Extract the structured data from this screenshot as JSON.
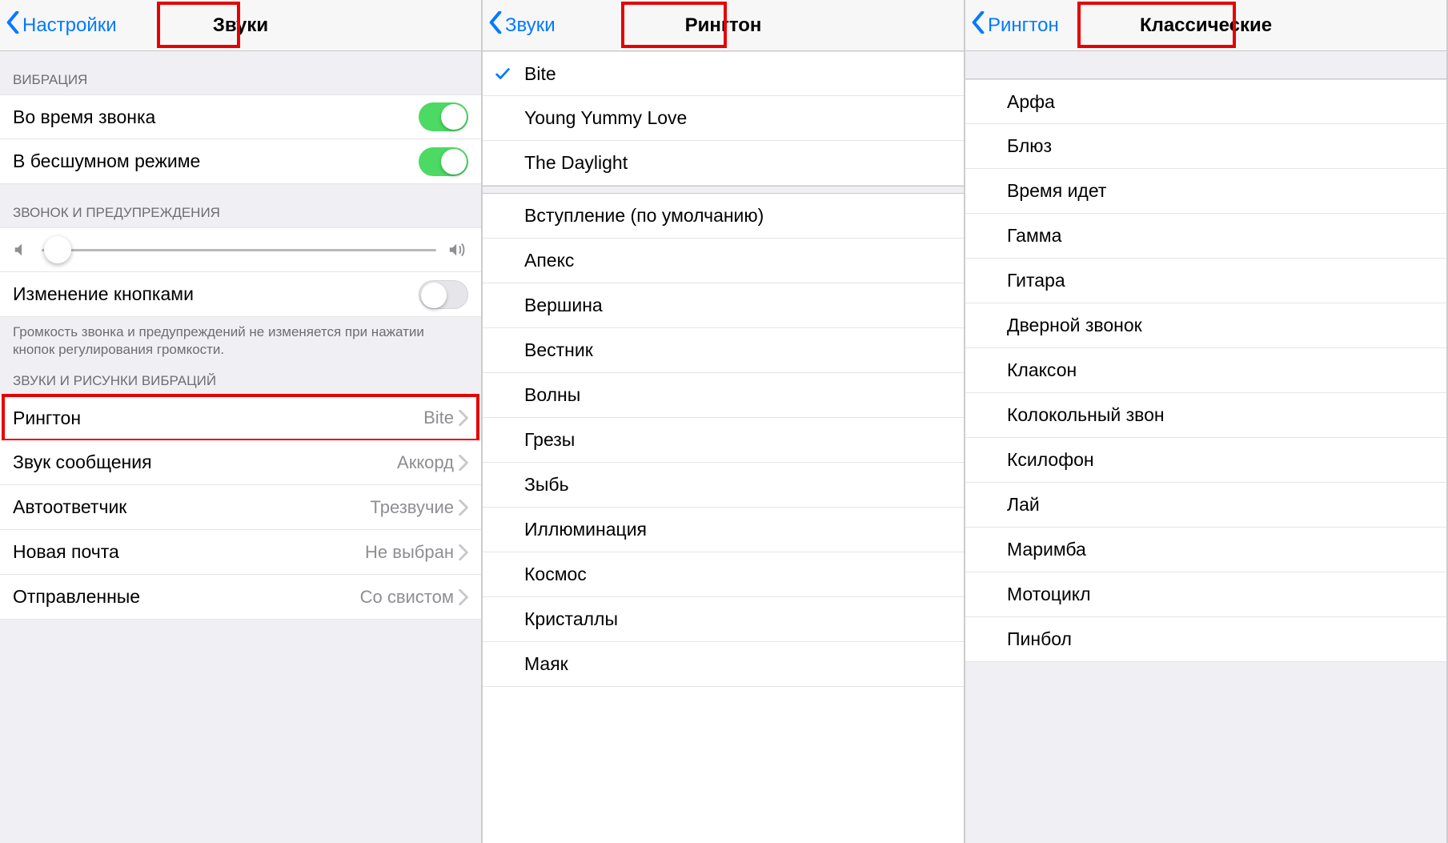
{
  "screen1": {
    "back": "Настройки",
    "title": "Звуки",
    "section_vibration": "Вибрация",
    "row_during_call": "Во время звонка",
    "row_silent_mode": "В бесшумном режиме",
    "section_ringer": "Звонок и предупреждения",
    "row_change_buttons": "Изменение кнопками",
    "footer_buttons": "Громкость звонка и предупреждений не изменяется при нажатии кнопок регулирования громкости.",
    "section_sounds": "Звуки и рисунки вибраций",
    "rows": {
      "ringtone": {
        "label": "Рингтон",
        "value": "Bite"
      },
      "text_tone": {
        "label": "Звук сообщения",
        "value": "Аккорд"
      },
      "voicemail": {
        "label": "Автоответчик",
        "value": "Трезвучие"
      },
      "new_mail": {
        "label": "Новая почта",
        "value": "Не выбран"
      },
      "sent_mail": {
        "label": "Отправленные",
        "value": "Со свистом"
      }
    }
  },
  "screen2": {
    "back": "Звуки",
    "title": "Рингтон",
    "selected": "Bite",
    "custom": [
      "Bite",
      "Young Yummy Love",
      "The Daylight"
    ],
    "builtin": [
      "Вступление (по умолчанию)",
      "Апекс",
      "Вершина",
      "Вестник",
      "Волны",
      "Грезы",
      "Зыбь",
      "Иллюминация",
      "Космос",
      "Кристаллы",
      "Маяк"
    ]
  },
  "screen3": {
    "back": "Рингтон",
    "title": "Классические",
    "items": [
      "Арфа",
      "Блюз",
      "Время идет",
      "Гамма",
      "Гитара",
      "Дверной звонок",
      "Клаксон",
      "Колокольный звон",
      "Ксилофон",
      "Лай",
      "Маримба",
      "Мотоцикл",
      "Пинбол"
    ]
  }
}
